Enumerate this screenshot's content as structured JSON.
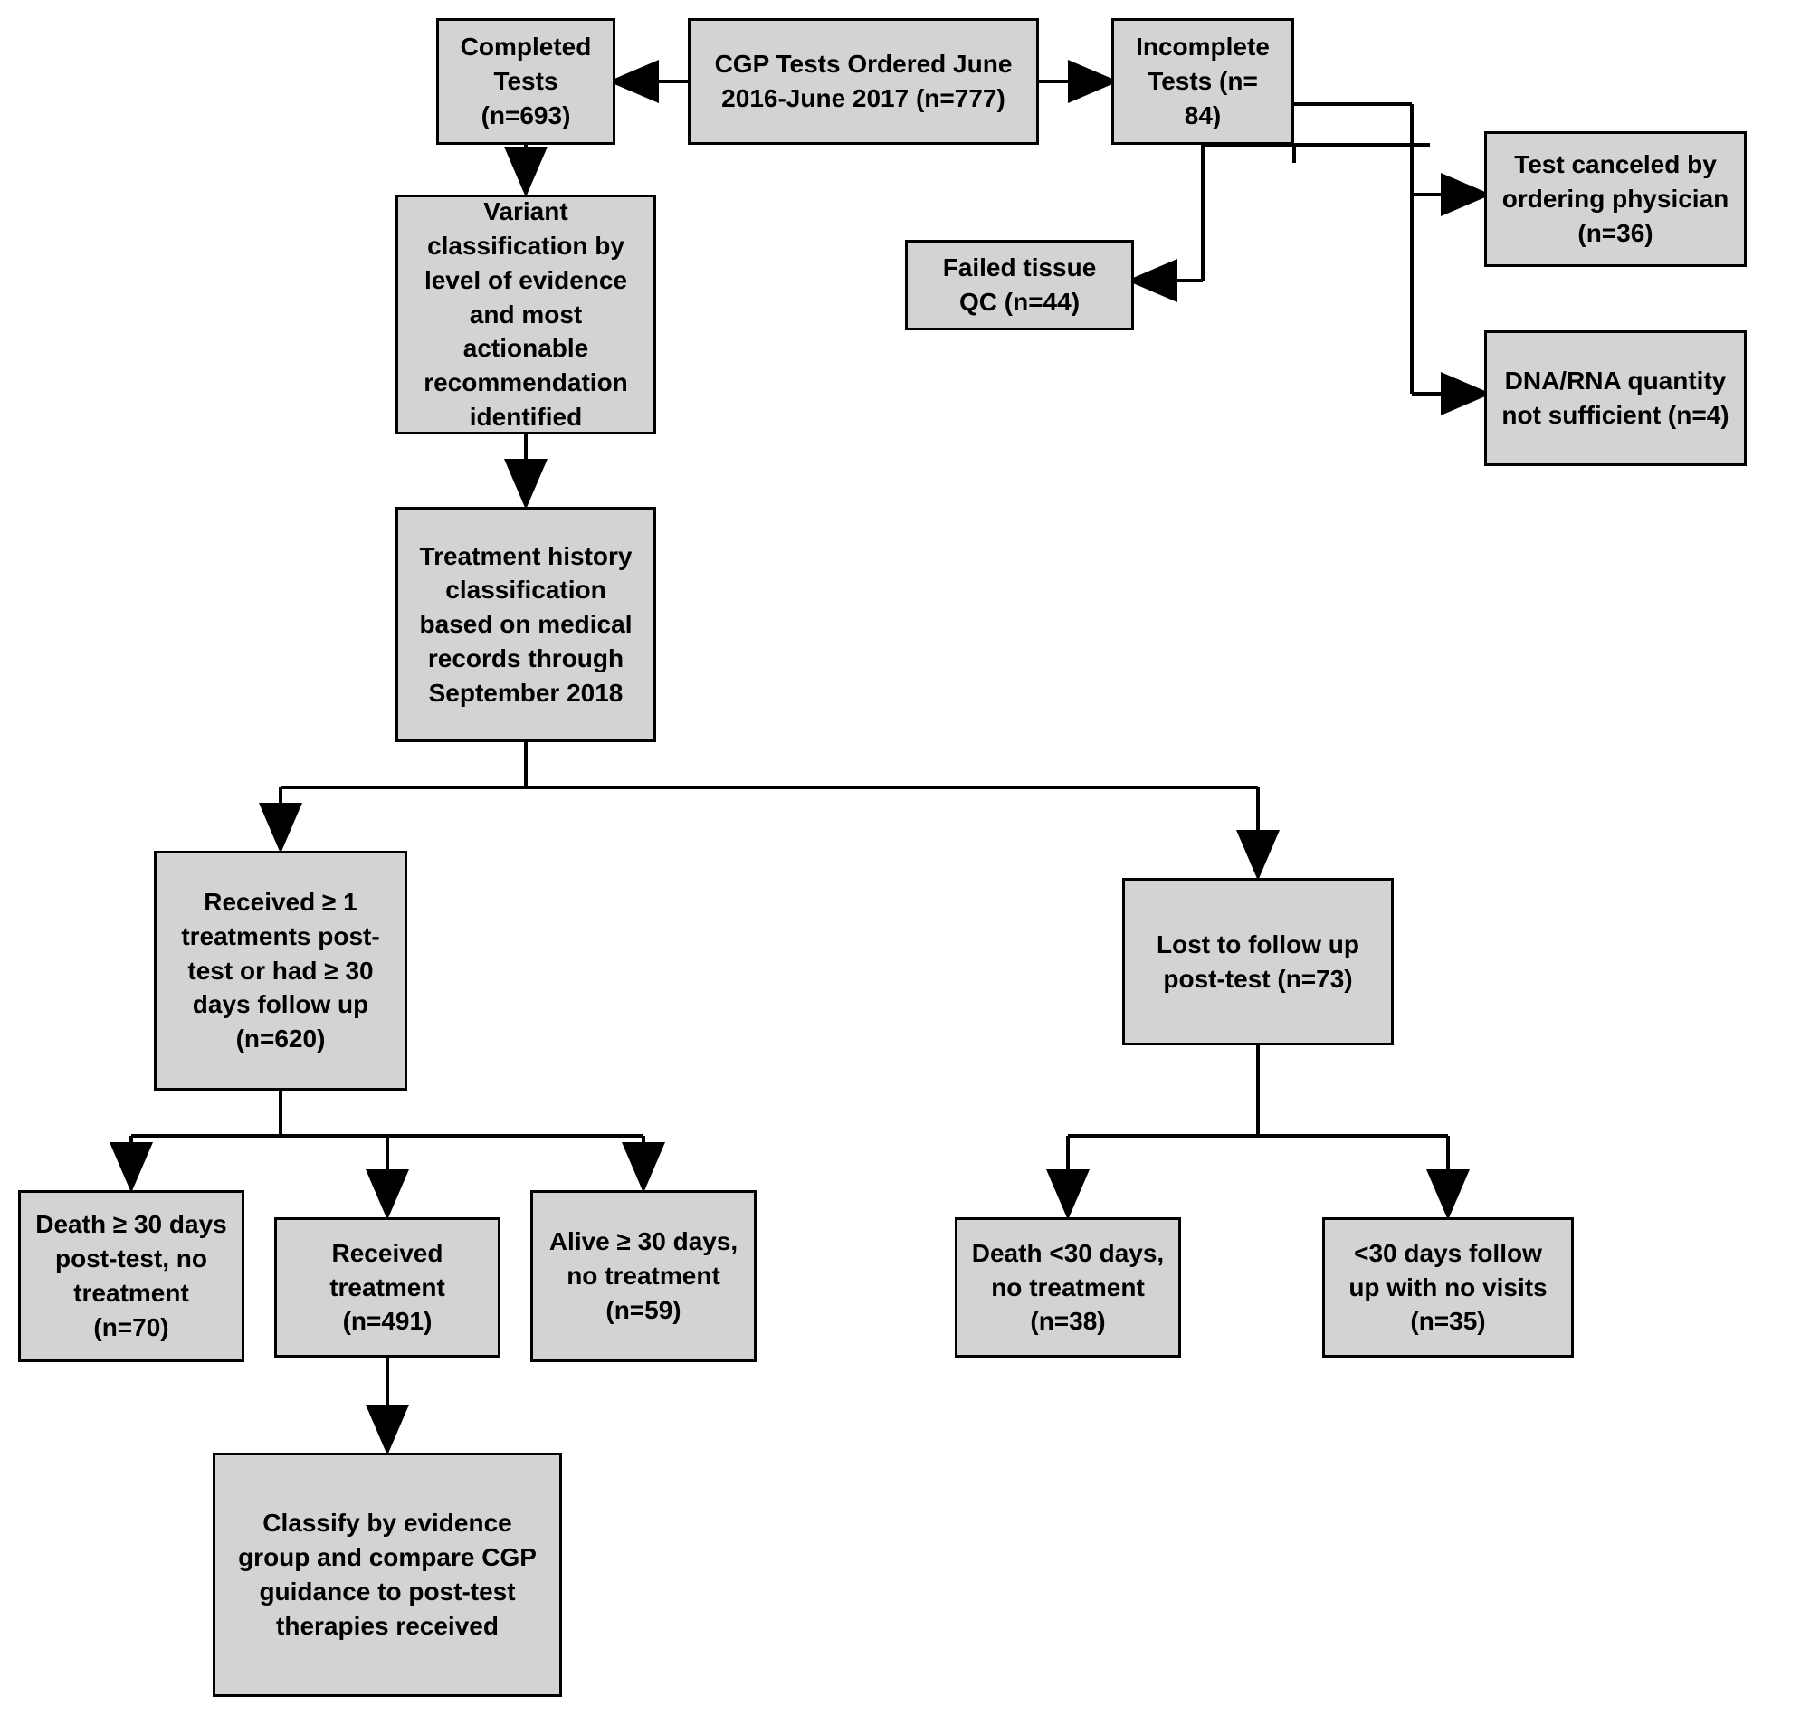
{
  "flowchart": {
    "nodes": {
      "cgp_ordered": "CGP Tests Ordered June 2016-June 2017 (n=777)",
      "completed": "Completed Tests (n=693)",
      "incomplete": "Incomplete Tests (n= 84)",
      "test_canceled": "Test canceled by ordering physician (n=36)",
      "failed_qc": "Failed tissue QC (n=44)",
      "dna_rna": "DNA/RNA quantity not sufficient (n=4)",
      "variant_classification": "Variant classification by level of evidence and most actionable recommendation identified",
      "treatment_history": "Treatment history classification based on medical records through September 2018",
      "received_ge1": "Received ≥ 1 treatments post-test or had ≥ 30 days follow up (n=620)",
      "lost_followup": "Lost to follow up post-test (n=73)",
      "death_ge30": "Death ≥ 30 days post-test, no treatment (n=70)",
      "received_treatment": "Received treatment (n=491)",
      "alive_ge30": "Alive ≥ 30 days, no treatment (n=59)",
      "death_lt30": "Death <30 days, no treatment (n=38)",
      "lt30_followup": "<30 days follow up with no visits (n=35)",
      "classify_evidence": "Classify by evidence group and compare CGP guidance  to post-test therapies received"
    }
  }
}
